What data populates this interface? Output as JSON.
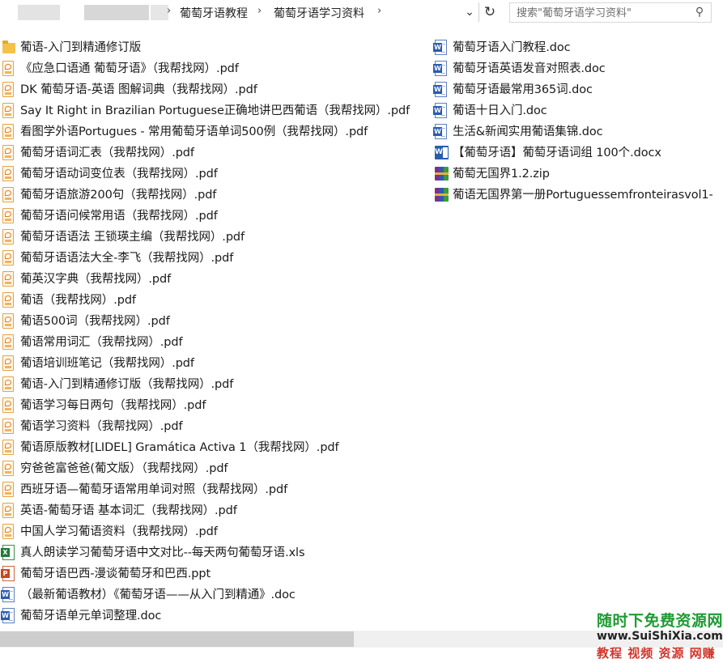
{
  "address_bar": {
    "breadcrumbs": [
      "葡萄牙语教程",
      "葡萄牙语学习资料"
    ],
    "separator": "›",
    "dropdown_icon": "chevron-down-icon",
    "refresh_icon": "refresh-icon"
  },
  "search": {
    "placeholder": "搜索\"葡萄牙语学习资料\"",
    "icon": "search-icon"
  },
  "files_left": [
    {
      "name": "葡语-入门到精通修订版",
      "type": "folder"
    },
    {
      "name": "《应急口语通 葡萄牙语》（我帮找网）.pdf",
      "type": "pdf"
    },
    {
      "name": "DK 葡萄牙语-英语 图解词典（我帮找网）.pdf",
      "type": "pdf"
    },
    {
      "name": "Say It Right in Brazilian Portuguese正确地讲巴西葡语（我帮找网）.pdf",
      "type": "pdf"
    },
    {
      "name": "看图学外语Portugues - 常用葡萄牙语单词500例（我帮找网）.pdf",
      "type": "pdf"
    },
    {
      "name": "葡萄牙语词汇表（我帮找网）.pdf",
      "type": "pdf"
    },
    {
      "name": "葡萄牙语动词变位表（我帮找网）.pdf",
      "type": "pdf"
    },
    {
      "name": "葡萄牙语旅游200句（我帮找网）.pdf",
      "type": "pdf"
    },
    {
      "name": "葡萄牙语问候常用语（我帮找网）.pdf",
      "type": "pdf"
    },
    {
      "name": "葡萄牙语语法 王锁瑛主编（我帮找网）.pdf",
      "type": "pdf"
    },
    {
      "name": "葡萄牙语语法大全-李飞（我帮找网）.pdf",
      "type": "pdf"
    },
    {
      "name": "葡英汉字典（我帮找网）.pdf",
      "type": "pdf"
    },
    {
      "name": "葡语（我帮找网）.pdf",
      "type": "pdf"
    },
    {
      "name": "葡语500词（我帮找网）.pdf",
      "type": "pdf"
    },
    {
      "name": "葡语常用词汇（我帮找网）.pdf",
      "type": "pdf"
    },
    {
      "name": "葡语培训班笔记（我帮找网）.pdf",
      "type": "pdf"
    },
    {
      "name": "葡语-入门到精通修订版（我帮找网）.pdf",
      "type": "pdf"
    },
    {
      "name": "葡语学习每日两句（我帮找网）.pdf",
      "type": "pdf"
    },
    {
      "name": "葡语学习资料（我帮找网）.pdf",
      "type": "pdf"
    },
    {
      "name": "葡语原版教材[LIDEL] Gramática Activa 1（我帮找网）.pdf",
      "type": "pdf"
    },
    {
      "name": "穷爸爸富爸爸(葡文版）（我帮找网）.pdf",
      "type": "pdf"
    },
    {
      "name": "西班牙语—葡萄牙语常用单词对照（我帮找网）.pdf",
      "type": "pdf"
    },
    {
      "name": "英语-葡萄牙语 基本词汇（我帮找网）.pdf",
      "type": "pdf"
    },
    {
      "name": "中国人学习葡语资料（我帮找网）.pdf",
      "type": "pdf"
    },
    {
      "name": "真人朗读学习葡萄牙语中文对比--每天两句葡萄牙语.xls",
      "type": "xls"
    },
    {
      "name": "葡萄牙语巴西-漫谈葡萄牙和巴西.ppt",
      "type": "ppt"
    },
    {
      "name": "（最新葡语教材）《葡萄牙语——从入门到精通》.doc",
      "type": "doc"
    },
    {
      "name": "葡萄牙语单元单词整理.doc",
      "type": "doc"
    }
  ],
  "files_right": [
    {
      "name": "葡萄牙语入门教程.doc",
      "type": "doc"
    },
    {
      "name": "葡萄牙语英语发音对照表.doc",
      "type": "doc"
    },
    {
      "name": "葡萄牙语最常用365词.doc",
      "type": "doc"
    },
    {
      "name": "葡语十日入门.doc",
      "type": "doc"
    },
    {
      "name": "生活&新闻实用葡语集锦.doc",
      "type": "doc"
    },
    {
      "name": "【葡萄牙语】葡萄牙语词组 100个.docx",
      "type": "docx"
    },
    {
      "name": "葡萄无国界1.2.zip",
      "type": "zip"
    },
    {
      "name": "葡语无国界第一册Portuguessemfronteirasvol1-",
      "type": "zip"
    }
  ],
  "scrollbar": {
    "horizontal_position_fraction": 0.0,
    "visible_fraction": 0.49
  },
  "watermark": {
    "line1": "随时下免费资源网",
    "line2": "www.SuiShiXia.com",
    "line3": "教程 视频 资源 网赚"
  },
  "colors": {
    "folder": "#f5c14b",
    "pdf": "#e07b1f",
    "word": "#2b5caf",
    "excel": "#1e7a38",
    "powerpoint": "#c9481c",
    "watermark_green": "#1f9b33",
    "watermark_red": "#d2342a"
  }
}
